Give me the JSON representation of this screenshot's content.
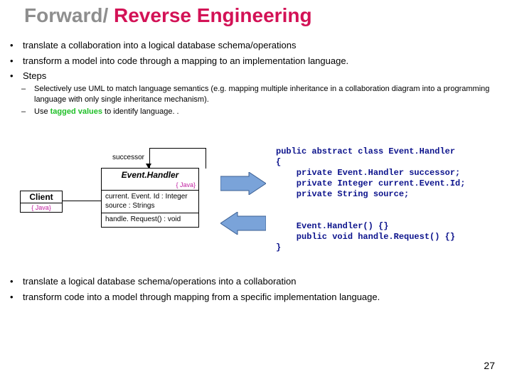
{
  "title": {
    "fwd": "Forward/",
    "rev": " Reverse Engineering"
  },
  "bullets1": [
    "translate a collaboration into a logical database schema/operations",
    "transform a model into code through a mapping to an implementation language.",
    "Steps"
  ],
  "sub": [
    {
      "pre": "Selectively use UML to match language semantics (e.g. mapping multiple inheritance in a collaboration diagram into a programming language with only single inheritance mechanism).",
      "tag": "",
      "post": ""
    },
    {
      "pre": "Use ",
      "tag": "tagged values",
      "post": " to identify language. ."
    }
  ],
  "client": {
    "name": "Client",
    "tag": "{ Java}"
  },
  "succ": "successor",
  "cls": {
    "name": "Event.Handler",
    "tag": "{ Java}",
    "a1": "current. Event. Id : Integer",
    "a2": "source : Strings",
    "o1": "handle. Request() : void"
  },
  "code": "public abstract class Event.Handler\n{\n    private Event.Handler successor;\n    private Integer current.Event.Id;\n    private String source;\n\n\n    Event.Handler() {}\n    public void handle.Request() {}\n}",
  "bullets2": [
    "translate a logical database schema/operations into a collaboration",
    "transform code into a model through mapping from a specific implementation language."
  ],
  "page": "27"
}
